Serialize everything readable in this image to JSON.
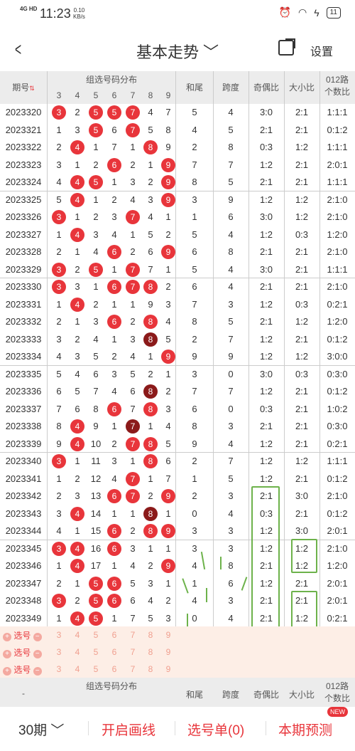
{
  "status": {
    "net": "4G HD",
    "time": "11:23",
    "speed_val": "0.10",
    "speed_unit": "KB/s",
    "battery": "11"
  },
  "nav": {
    "title": "基本走势 ﹀",
    "settings": "设置"
  },
  "header": {
    "period": "期号",
    "group": "组选号码分布",
    "digits": [
      "3",
      "4",
      "5",
      "6",
      "7",
      "8",
      "9"
    ],
    "hewei": "和尾",
    "kuadu": "跨度",
    "jiou": "奇偶比",
    "daxiao": "大小比",
    "lu1": "012路",
    "lu2": "个数比"
  },
  "rows": [
    {
      "p": "2023320",
      "d": [
        "3",
        "2",
        "5",
        "5",
        "7",
        "4",
        "7"
      ],
      "b": [
        0,
        2,
        3,
        4
      ],
      "h": "5",
      "k": "4",
      "j": "3:0",
      "x": "2:1",
      "l": "1:1:1"
    },
    {
      "p": "2023321",
      "d": [
        "1",
        "3",
        "5",
        "6",
        "7",
        "5",
        "8"
      ],
      "b": [
        2,
        4
      ],
      "h": "4",
      "k": "5",
      "j": "2:1",
      "x": "2:1",
      "l": "0:1:2"
    },
    {
      "p": "2023322",
      "d": [
        "2",
        "4",
        "1",
        "7",
        "1",
        "8",
        "9"
      ],
      "b": [
        1,
        5
      ],
      "h": "2",
      "k": "8",
      "j": "0:3",
      "x": "1:2",
      "l": "1:1:1"
    },
    {
      "p": "2023323",
      "d": [
        "3",
        "1",
        "2",
        "6",
        "2",
        "1",
        "9"
      ],
      "b": [
        3,
        6
      ],
      "h": "7",
      "k": "7",
      "j": "1:2",
      "x": "2:1",
      "l": "2:0:1"
    },
    {
      "p": "2023324",
      "d": [
        "4",
        "4",
        "5",
        "1",
        "3",
        "2",
        "9"
      ],
      "b": [
        1,
        2,
        6
      ],
      "h": "8",
      "k": "5",
      "j": "2:1",
      "x": "2:1",
      "l": "1:1:1"
    },
    {
      "p": "2023325",
      "d": [
        "5",
        "4",
        "1",
        "2",
        "4",
        "3",
        "9"
      ],
      "b": [
        1,
        6
      ],
      "h": "3",
      "k": "9",
      "j": "1:2",
      "x": "1:2",
      "l": "2:1:0"
    },
    {
      "p": "2023326",
      "d": [
        "3",
        "1",
        "2",
        "3",
        "7",
        "4",
        "1"
      ],
      "b": [
        0,
        4
      ],
      "h": "1",
      "k": "6",
      "j": "3:0",
      "x": "1:2",
      "l": "2:1:0"
    },
    {
      "p": "2023327",
      "d": [
        "1",
        "4",
        "3",
        "4",
        "1",
        "5",
        "2"
      ],
      "b": [
        1
      ],
      "h": "5",
      "k": "4",
      "j": "1:2",
      "x": "0:3",
      "l": "1:2:0"
    },
    {
      "p": "2023328",
      "d": [
        "2",
        "1",
        "4",
        "6",
        "2",
        "6",
        "9"
      ],
      "b": [
        3,
        6
      ],
      "h": "6",
      "k": "8",
      "j": "2:1",
      "x": "2:1",
      "l": "2:1:0"
    },
    {
      "p": "2023329",
      "d": [
        "3",
        "2",
        "5",
        "1",
        "7",
        "7",
        "1"
      ],
      "b": [
        0,
        2,
        4
      ],
      "h": "5",
      "k": "4",
      "j": "3:0",
      "x": "2:1",
      "l": "1:1:1"
    },
    {
      "p": "2023330",
      "d": [
        "3",
        "3",
        "1",
        "6",
        "7",
        "8",
        "2"
      ],
      "b": [
        0,
        3,
        4,
        5
      ],
      "h": "6",
      "k": "4",
      "j": "2:1",
      "x": "2:1",
      "l": "2:1:0"
    },
    {
      "p": "2023331",
      "d": [
        "1",
        "4",
        "2",
        "1",
        "1",
        "9",
        "3"
      ],
      "b": [
        1
      ],
      "h": "7",
      "k": "3",
      "j": "1:2",
      "x": "0:3",
      "l": "0:2:1"
    },
    {
      "p": "2023332",
      "d": [
        "2",
        "1",
        "3",
        "6",
        "2",
        "8",
        "4"
      ],
      "b": [
        3,
        5
      ],
      "h": "8",
      "k": "5",
      "j": "2:1",
      "x": "1:2",
      "l": "1:2:0"
    },
    {
      "p": "2023333",
      "d": [
        "3",
        "2",
        "4",
        "1",
        "3",
        "8",
        "5"
      ],
      "b": [
        5
      ],
      "h": "2",
      "k": "7",
      "j": "1:2",
      "x": "2:1",
      "l": "0:1:2"
    },
    {
      "p": "2023334",
      "d": [
        "4",
        "3",
        "5",
        "2",
        "4",
        "1",
        "9"
      ],
      "b": [
        6
      ],
      "h": "9",
      "k": "9",
      "j": "1:2",
      "x": "1:2",
      "l": "3:0:0"
    },
    {
      "p": "2023335",
      "d": [
        "5",
        "4",
        "6",
        "3",
        "5",
        "2",
        "1"
      ],
      "b": [],
      "h": "3",
      "k": "0",
      "j": "3:0",
      "x": "0:3",
      "l": "0:3:0"
    },
    {
      "p": "2023336",
      "d": [
        "6",
        "5",
        "7",
        "4",
        "6",
        "8",
        "2"
      ],
      "b": [
        5
      ],
      "h": "7",
      "k": "7",
      "j": "1:2",
      "x": "2:1",
      "l": "0:1:2"
    },
    {
      "p": "2023337",
      "d": [
        "7",
        "6",
        "8",
        "6",
        "7",
        "8",
        "3"
      ],
      "b": [
        3,
        5
      ],
      "h": "6",
      "k": "0",
      "j": "0:3",
      "x": "2:1",
      "l": "1:0:2"
    },
    {
      "p": "2023338",
      "d": [
        "8",
        "4",
        "9",
        "1",
        "7",
        "1",
        "4"
      ],
      "b": [
        1,
        4
      ],
      "h": "8",
      "k": "3",
      "j": "2:1",
      "x": "2:1",
      "l": "0:3:0"
    },
    {
      "p": "2023339",
      "d": [
        "9",
        "4",
        "10",
        "2",
        "7",
        "8",
        "5"
      ],
      "b": [
        1,
        4,
        5
      ],
      "h": "9",
      "k": "4",
      "j": "1:2",
      "x": "2:1",
      "l": "0:2:1"
    },
    {
      "p": "2023340",
      "d": [
        "3",
        "1",
        "11",
        "3",
        "1",
        "8",
        "6"
      ],
      "b": [
        0,
        5
      ],
      "h": "2",
      "k": "7",
      "j": "1:2",
      "x": "1:2",
      "l": "1:1:1"
    },
    {
      "p": "2023341",
      "d": [
        "1",
        "2",
        "12",
        "4",
        "7",
        "1",
        "7"
      ],
      "b": [
        4
      ],
      "h": "1",
      "k": "5",
      "j": "1:2",
      "x": "2:1",
      "l": "0:1:2"
    },
    {
      "p": "2023342",
      "d": [
        "2",
        "3",
        "13",
        "6",
        "7",
        "2",
        "9"
      ],
      "b": [
        3,
        4,
        6
      ],
      "h": "2",
      "k": "3",
      "j": "2:1",
      "x": "3:0",
      "l": "2:1:0"
    },
    {
      "p": "2023343",
      "d": [
        "3",
        "4",
        "14",
        "1",
        "1",
        "8",
        "1"
      ],
      "b": [
        1,
        5
      ],
      "h": "0",
      "k": "4",
      "j": "0:3",
      "x": "2:1",
      "l": "0:1:2"
    },
    {
      "p": "2023344",
      "d": [
        "4",
        "1",
        "15",
        "6",
        "2",
        "8",
        "9"
      ],
      "b": [
        3,
        5,
        6
      ],
      "h": "3",
      "k": "3",
      "j": "1:2",
      "x": "3:0",
      "l": "2:0:1"
    },
    {
      "p": "2023345",
      "d": [
        "3",
        "4",
        "16",
        "6",
        "3",
        "1",
        "1"
      ],
      "b": [
        0,
        1,
        3
      ],
      "h": "3",
      "k": "3",
      "j": "1:2",
      "x": "1:2",
      "l": "2:1:0"
    },
    {
      "p": "2023346",
      "d": [
        "1",
        "4",
        "17",
        "1",
        "4",
        "2",
        "9"
      ],
      "b": [
        1,
        6
      ],
      "h": "4",
      "k": "8",
      "j": "2:1",
      "x": "1:2",
      "l": "1:2:0"
    },
    {
      "p": "2023347",
      "d": [
        "2",
        "1",
        "5",
        "6",
        "5",
        "3",
        "1"
      ],
      "b": [
        2,
        3
      ],
      "h": "1",
      "k": "6",
      "j": "1:2",
      "x": "2:1",
      "l": "2:0:1"
    },
    {
      "p": "2023348",
      "d": [
        "3",
        "2",
        "5",
        "6",
        "6",
        "4",
        "2"
      ],
      "b": [
        0,
        2,
        3
      ],
      "h": "4",
      "k": "3",
      "j": "2:1",
      "x": "2:1",
      "l": "2:0:1"
    },
    {
      "p": "2023349",
      "d": [
        "1",
        "4",
        "5",
        "1",
        "7",
        "5",
        "3"
      ],
      "b": [
        1,
        2
      ],
      "h": "0",
      "k": "4",
      "j": "2:1",
      "x": "1:2",
      "l": "0:2:1"
    }
  ],
  "darkballs": [
    [
      13,
      5
    ],
    [
      16,
      5
    ],
    [
      18,
      4
    ],
    [
      23,
      5
    ]
  ],
  "select": {
    "label": "选号",
    "digits": [
      "3",
      "4",
      "5",
      "6",
      "7",
      "8",
      "9"
    ]
  },
  "footer_dash": "-",
  "bottom": {
    "periods": "30期 ﹀",
    "draw": "开启画线",
    "slip": "选号单(0)",
    "predict": "本期预测",
    "new": "NEW"
  }
}
